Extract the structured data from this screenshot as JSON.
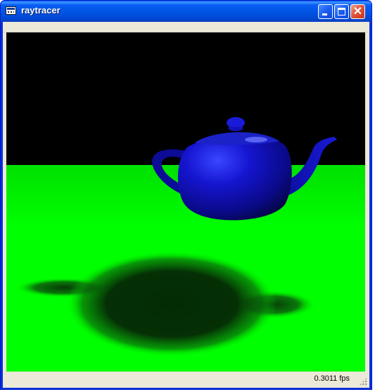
{
  "window": {
    "title": "raytracer",
    "icon": "app-window-icon",
    "controls": [
      "minimize-icon",
      "maximize-icon",
      "close-icon"
    ]
  },
  "viewport": {
    "scene": "blue teapot floating over green plane casting shadow",
    "colors": {
      "sky": "#000000",
      "floor": "#00ff00",
      "teapot": "#1a1ad9",
      "shadow": "#032c03"
    }
  },
  "statusbar": {
    "fps": "0.3011 fps"
  }
}
